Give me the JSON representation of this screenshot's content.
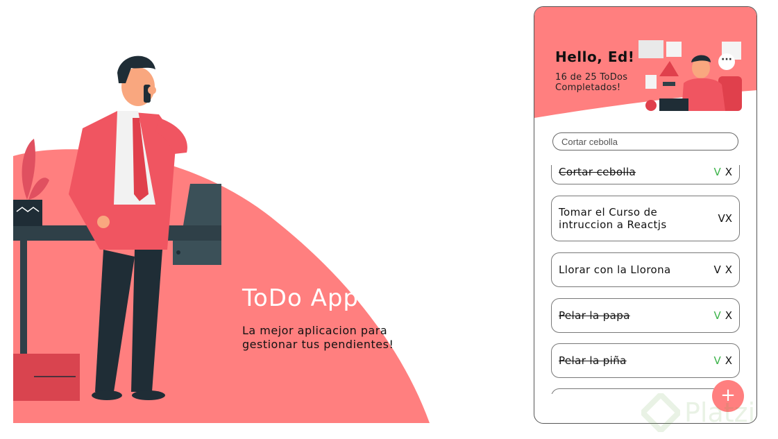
{
  "hero": {
    "title": "ToDo App",
    "subtitle": "La mejor aplicacion para gestionar tus pendientes!"
  },
  "header": {
    "greeting": "Hello, Ed!",
    "progress": "16 de 25 ToDos Completados!",
    "menu_icon_label": "···"
  },
  "search": {
    "placeholder": "Cortar cebolla"
  },
  "todos": [
    {
      "text": "Cortar cebolla",
      "completed": true,
      "check": "V",
      "delete": "X"
    },
    {
      "text": "Tomar el Curso de intruccion a Reactjs",
      "completed": false,
      "check": "V",
      "delete": "X"
    },
    {
      "text": "Llorar con la Llorona",
      "completed": false,
      "check": "V",
      "delete": "X"
    },
    {
      "text": "Pelar la papa",
      "completed": true,
      "check": "V",
      "delete": "X"
    },
    {
      "text": "Pelar la piña",
      "completed": true,
      "check": "V",
      "delete": "X"
    }
  ],
  "add_button": {
    "label": "+"
  },
  "watermark": {
    "text": "Platzi"
  },
  "colors": {
    "accent": "#ff7f7f",
    "check_green": "#3cb34a",
    "dark_navy": "#1f2d36"
  }
}
